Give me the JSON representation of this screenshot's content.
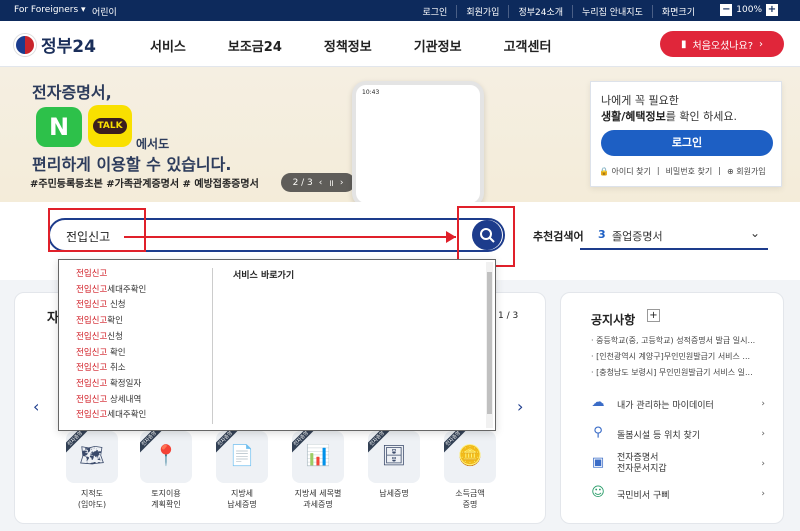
{
  "topbar": {
    "foreigners": "For Foreigners ▾",
    "kids": "어린이",
    "links": [
      "로그인",
      "회원가입",
      "정부24소개",
      "누리집 안내지도",
      "화면크기"
    ],
    "zoom": "100%"
  },
  "header": {
    "logo": "정부24",
    "nav": [
      "서비스",
      "보조금24",
      "정책정보",
      "기관정보",
      "고객센터"
    ],
    "cta": "처음오셨나요?"
  },
  "banner": {
    "line1": "전자증명서,",
    "line2": "에서도",
    "line3": "편리하게 이용할 수 있습니다.",
    "tags": "#주민등록등초본  #가족관계증명서  # 예방접종증명서",
    "naver": "N",
    "kakao": "TALK",
    "pager": "2 / 3",
    "phone_time": "10:43"
  },
  "login": {
    "line1": "나에게 꼭 필요한",
    "line2_bold": "생활/혜택정보",
    "line2_rest": "를 확인 하세요.",
    "button": "로그인",
    "links": [
      "아이디 찾기",
      "비밀번호 찾기",
      "회원가입"
    ]
  },
  "search": {
    "value": "전입신고",
    "rec_label": "추천검색어",
    "rec_num": "3",
    "rec_value": "졸업증명서"
  },
  "dropdown": {
    "hit": "전입신고",
    "items": [
      "",
      "세대주확인",
      " 신청",
      "확인",
      "신청",
      " 확인",
      " 취소",
      " 확정일자",
      " 상세내역",
      "세대주확인"
    ],
    "shortcut": "서비스 바로가기"
  },
  "left": {
    "title": "자",
    "page": "1 / 3",
    "services": [
      {
        "label": "지적도\n(임야도)",
        "sym": "🗺"
      },
      {
        "label": "토지이용\n계획확인",
        "sym": "📍"
      },
      {
        "label": "지방세\n납세증명",
        "sym": "📄"
      },
      {
        "label": "지방세 세목별\n과세증명",
        "sym": "📊"
      },
      {
        "label": "납세증명",
        "sym": "🗄"
      },
      {
        "label": "소득금액\n증명",
        "sym": "🪙"
      }
    ],
    "badge": "전자증명"
  },
  "right": {
    "title": "공지사항",
    "notices": [
      "· 중등학교(중, 고등학교) 성적증명서 발급 일시...",
      "· [인천광역시 계양구]무인민원발급기 서비스 ...",
      "· [충청남도 보령시] 무인민원발급기 서비스 일..."
    ],
    "items": [
      {
        "label": "내가 관리하는 마이데이터",
        "sym": "☁"
      },
      {
        "label": "돌봄시설 등 위치 찾기",
        "sym": "⚲"
      },
      {
        "label": "전자증명서\n전자문서지갑",
        "sym": "▣"
      },
      {
        "label": "국민비서 구삐",
        "sym": "☺"
      }
    ]
  }
}
